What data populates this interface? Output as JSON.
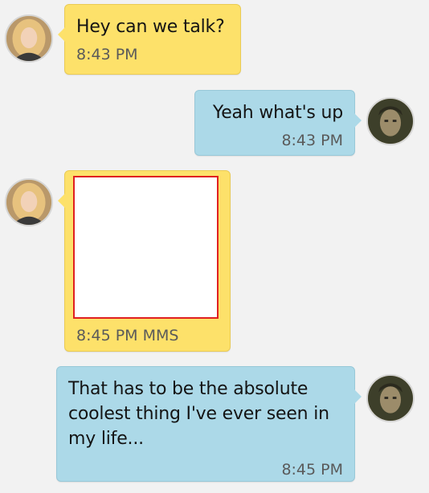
{
  "messages": [
    {
      "direction": "incoming",
      "text": "Hey can we talk?",
      "time": "8:43 PM",
      "avatar": "female-avatar"
    },
    {
      "direction": "outgoing",
      "text": "Yeah what's up",
      "time": "8:43 PM",
      "avatar": "male-avatar"
    },
    {
      "direction": "incoming",
      "attachment": "image",
      "time": "8:45 PM MMS",
      "avatar": "female-avatar"
    },
    {
      "direction": "outgoing",
      "text": "That has to be the absolute coolest thing I've ever seen in my life...",
      "time": "8:45 PM",
      "avatar": "male-avatar"
    }
  ],
  "colors": {
    "incoming_bubble": "#fde16a",
    "outgoing_bubble": "#acd9e8",
    "background": "#f2f2f2",
    "mms_border": "#e02020"
  }
}
